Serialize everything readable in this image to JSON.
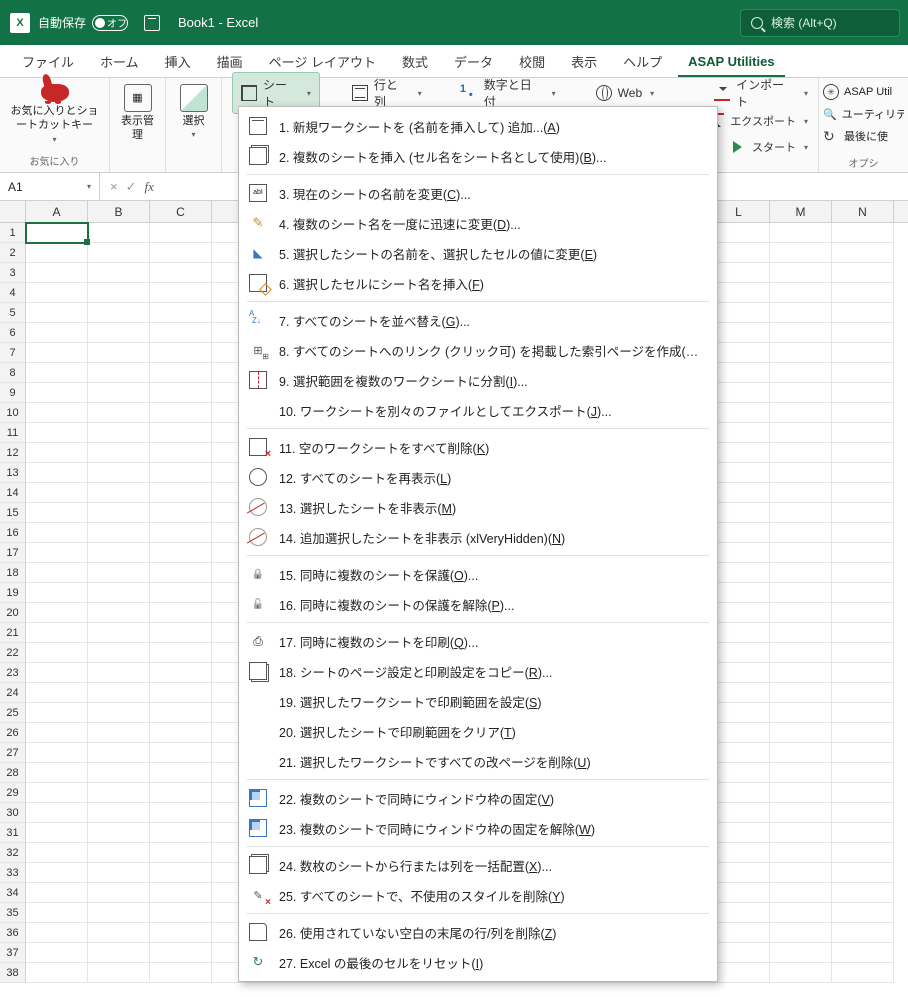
{
  "titlebar": {
    "autosave_label": "自動保存",
    "autosave_state": "オフ",
    "title": "Book1 - Excel",
    "search_placeholder": "検索 (Alt+Q)"
  },
  "tabs": [
    "ファイル",
    "ホーム",
    "挿入",
    "描画",
    "ページ レイアウト",
    "数式",
    "データ",
    "校閲",
    "表示",
    "ヘルプ",
    "ASAP Utilities"
  ],
  "active_tab": 10,
  "ribbon": {
    "fav_big": "お気に入りとショートカットキー",
    "fav_label": "お気に入り",
    "view_big": "表示管理",
    "select_big": "選択",
    "row1": {
      "sheet": "シート",
      "rows": "行と列",
      "numdate": "数字と日付",
      "web": "Web"
    },
    "row2": {
      "import": "インポート",
      "export": "エクスポート",
      "start": "スタート"
    },
    "right": {
      "asap": "ASAP Util",
      "utility": "ユーティリテ",
      "last": "最後に使",
      "footer": "オプシ"
    }
  },
  "namebox": "A1",
  "columns": [
    "A",
    "B",
    "C",
    "",
    "",
    "",
    "",
    "",
    "",
    "",
    "",
    "L",
    "M",
    "N"
  ],
  "row_count": 38,
  "menu": [
    {
      "ic": "mic-sheet",
      "n": "1.",
      "t": "新規ワークシートを (名前を挿入して) 追加...",
      "k": "A"
    },
    {
      "ic": "mic-multi",
      "n": "2.",
      "t": "複数のシートを挿入 (セル名をシート名として使用)",
      "k": "B",
      "ell": true
    },
    {
      "sep": true
    },
    {
      "ic": "mic-abl",
      "n": "3.",
      "t": "現在のシートの名前を変更",
      "k": "C",
      "ell": true
    },
    {
      "ic": "mic-pen",
      "n": "4.",
      "t": "複数のシート名を一度に迅速に変更",
      "k": "D",
      "ell": true
    },
    {
      "ic": "mic-tag",
      "n": "5.",
      "t": "選択したシートの名前を、選択したセルの値に変更",
      "k": "E"
    },
    {
      "ic": "mic-name",
      "n": "6.",
      "t": "選択したセルにシート名を挿入",
      "k": "F"
    },
    {
      "sep": true
    },
    {
      "ic": "mic-sort",
      "n": "7.",
      "t": "すべてのシートを並べ替え",
      "k": "G",
      "ell": true
    },
    {
      "ic": "mic-link",
      "n": "8.",
      "t": "すべてのシートへのリンク (クリック可) を掲載した索引ページを作成",
      "k": "H",
      "ell": true
    },
    {
      "ic": "mic-split",
      "n": "9.",
      "t": "選択範囲を複数のワークシートに分割",
      "k": "I",
      "ell": true
    },
    {
      "ic": "mic-blank",
      "n": "10.",
      "t": "ワークシートを別々のファイルとしてエクスポート",
      "k": "J",
      "ell": true
    },
    {
      "sep": true
    },
    {
      "ic": "mic-del",
      "n": "11.",
      "t": "空のワークシートをすべて削除",
      "k": "K"
    },
    {
      "ic": "mic-eye",
      "n": "12.",
      "t": "すべてのシートを再表示",
      "k": "L"
    },
    {
      "ic": "mic-hide",
      "n": "13.",
      "t": "選択したシートを非表示",
      "k": "M"
    },
    {
      "ic": "mic-hide",
      "n": "14.",
      "t": "追加選択したシートを非表示 (xlVeryHidden)",
      "k": "N"
    },
    {
      "sep": true
    },
    {
      "ic": "mic-lock",
      "n": "15.",
      "t": "同時に複数のシートを保護",
      "k": "O",
      "ell": true
    },
    {
      "ic": "mic-unlock",
      "n": "16.",
      "t": "同時に複数のシートの保護を解除",
      "k": "P",
      "ell": true
    },
    {
      "sep": true
    },
    {
      "ic": "mic-print",
      "n": "17.",
      "t": "同時に複数のシートを印刷",
      "k": "Q",
      "ell": true
    },
    {
      "ic": "mic-copy",
      "n": "18.",
      "t": "シートのページ設定と印刷設定をコピー",
      "k": "R",
      "ell": true
    },
    {
      "ic": "mic-blank",
      "n": "19.",
      "t": "選択したワークシートで印刷範囲を設定",
      "k": "S"
    },
    {
      "ic": "mic-blank",
      "n": "20.",
      "t": "選択したシートで印刷範囲をクリア",
      "k": "T"
    },
    {
      "ic": "mic-blank",
      "n": "21.",
      "t": "選択したワークシートですべての改ページを削除",
      "k": "U"
    },
    {
      "sep": true
    },
    {
      "ic": "mic-freeze",
      "n": "22.",
      "t": "複数のシートで同時にウィンドウ枠の固定",
      "k": "V"
    },
    {
      "ic": "mic-freeze",
      "n": "23.",
      "t": "複数のシートで同時にウィンドウ枠の固定を解除",
      "k": "W"
    },
    {
      "sep": true
    },
    {
      "ic": "mic-multi",
      "n": "24.",
      "t": "数枚のシートから行または列を一括配置",
      "k": "X",
      "ell": true
    },
    {
      "ic": "mic-style",
      "n": "25.",
      "t": "すべてのシートで、不使用のスタイルを削除",
      "k": "Y"
    },
    {
      "sep": true
    },
    {
      "ic": "mic-page",
      "n": "26.",
      "t": "使用されていない空白の末尾の行/列を削除",
      "k": "Z"
    },
    {
      "ic": "mic-reset",
      "n": "27.",
      "t": "Excel の最後のセルをリセット",
      "k": "I"
    }
  ]
}
